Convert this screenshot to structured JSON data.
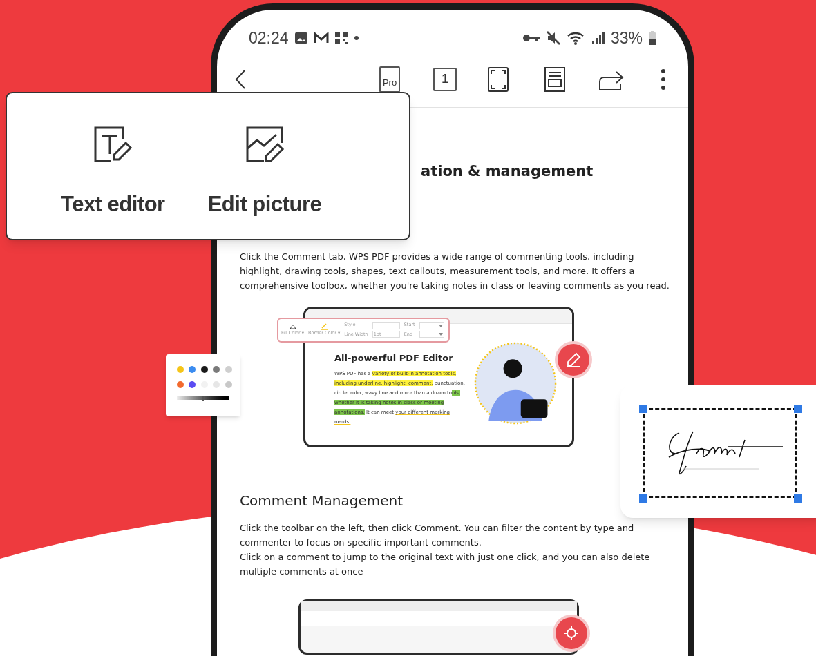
{
  "status_bar": {
    "time": "02:24",
    "battery": "33%"
  },
  "toolbar": {
    "pro_label": "Pro",
    "page_number": "1"
  },
  "feature_card": {
    "items": [
      {
        "label": "Text editor",
        "kind": "text"
      },
      {
        "label": "Edit picture",
        "kind": "picture"
      }
    ]
  },
  "document": {
    "heading_1": "ation & management",
    "paragraph_1": "Click the Comment tab, WPS PDF provides a wide range of commenting tools, including highlight, drawing tools, shapes, text callouts, measurement tools, and more. It offers a comprehensive toolbox, whether you're taking notes in class or leaving comments as you read.",
    "preview": {
      "toolbar": {
        "fill_color": "Fill Color ▾",
        "border_color": "Border Color ▾",
        "style": "Style",
        "line_width": "Line Width",
        "line_width_value": "1pt",
        "start": "Start",
        "end": "End"
      },
      "title": "All-powerful PDF Editor",
      "segments": [
        {
          "text": "WPS PDF has a ",
          "color": "#ffffff"
        },
        {
          "text": "variety of built-in annotation tools, including underline, highlight, comment,",
          "color": "#fff23a"
        },
        {
          "text": " punctuation, circle, ruler, wavy line and more than a dozen to",
          "color": "#ffffff"
        },
        {
          "text": "ols, whether it is taking notes in class or meeting annotations.",
          "color": "#7cc44a"
        },
        {
          "text": " It can meet ",
          "color": "#ffffff"
        },
        {
          "text": "your different marking needs.",
          "color": "#ffffff",
          "underline": true
        }
      ]
    },
    "heading_2": "Comment Management",
    "paragraph_2": [
      "Click the toolbar on the left, then click Comment. You can filter the content by type and commenter to focus on specific important comments.",
      "Click on a comment to jump to the original text with just one click, and you can also delete multiple comments at once"
    ]
  },
  "palette": {
    "slider": {
      "level": 0.5
    },
    "colors": [
      {
        "color": "#f5c518"
      },
      {
        "color": "#3b8cf0"
      },
      {
        "color": "#1a1a1a"
      },
      {
        "color": "#7a7a7a"
      },
      {
        "color": "#cfcfcf"
      },
      {
        "color": "#f26a2e"
      },
      {
        "color": "#5b4cf2"
      },
      {
        "color": "#f2f2f2"
      },
      {
        "color": "#e6e6e6"
      },
      {
        "color": "#c8c8c8"
      }
    ]
  }
}
